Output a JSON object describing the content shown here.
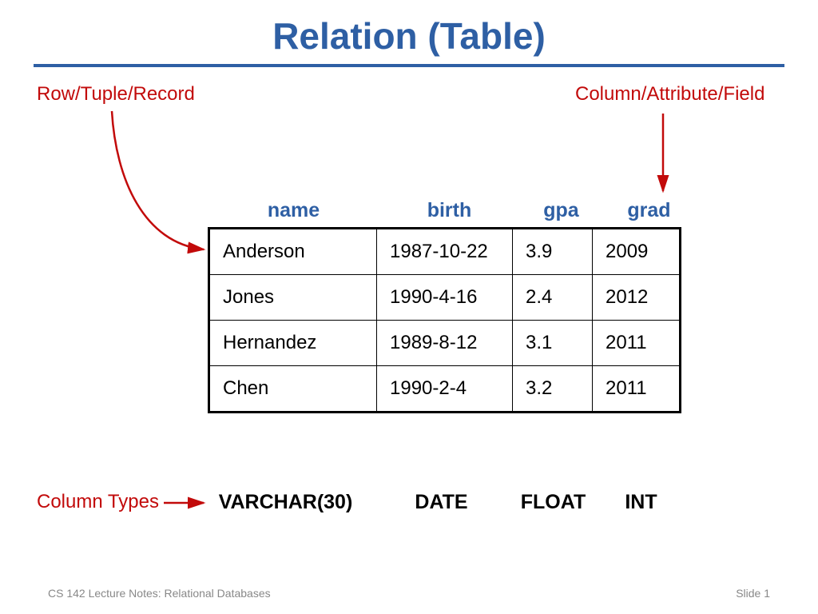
{
  "title": "Relation (Table)",
  "annotations": {
    "row": "Row/Tuple/Record",
    "column": "Column/Attribute/Field",
    "columnTypes": "Column Types"
  },
  "columns": [
    "name",
    "birth",
    "gpa",
    "grad"
  ],
  "columnTypes": [
    "VARCHAR(30)",
    "DATE",
    "FLOAT",
    "INT"
  ],
  "rows": [
    {
      "name": "Anderson",
      "birth": "1987-10-22",
      "gpa": "3.9",
      "grad": "2009"
    },
    {
      "name": "Jones",
      "birth": "1990-4-16",
      "gpa": "2.4",
      "grad": "2012"
    },
    {
      "name": "Hernandez",
      "birth": "1989-8-12",
      "gpa": "3.1",
      "grad": "2011"
    },
    {
      "name": "Chen",
      "birth": "1990-2-4",
      "gpa": "3.2",
      "grad": "2011"
    }
  ],
  "footer": {
    "left": "CS 142 Lecture Notes: Relational Databases",
    "right": "Slide 1"
  },
  "chart_data": {
    "type": "table",
    "title": "Relation (Table)",
    "columns": [
      "name",
      "birth",
      "gpa",
      "grad"
    ],
    "columnTypes": [
      "VARCHAR(30)",
      "DATE",
      "FLOAT",
      "INT"
    ],
    "rows": [
      [
        "Anderson",
        "1987-10-22",
        3.9,
        2009
      ],
      [
        "Jones",
        "1990-4-16",
        2.4,
        2012
      ],
      [
        "Hernandez",
        "1989-8-12",
        3.1,
        2011
      ],
      [
        "Chen",
        "1990-2-4",
        3.2,
        2011
      ]
    ]
  }
}
